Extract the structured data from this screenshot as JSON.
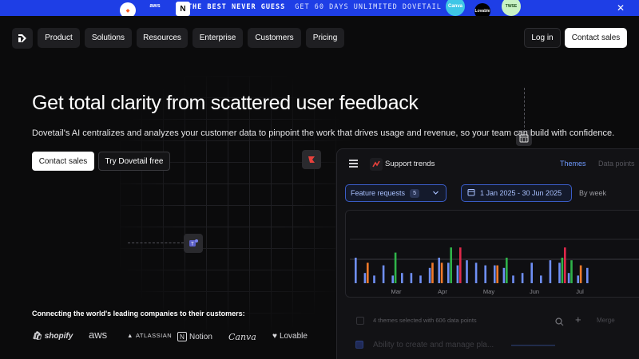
{
  "banner": {
    "headline": "THE BEST NEVER GUESS",
    "offer": "GET 60 DAYS UNLIMITED DOVETAIL →",
    "logos": [
      "aws",
      "Canva",
      "Lovable",
      "TWSE"
    ]
  },
  "nav": {
    "items": [
      "Product",
      "Solutions",
      "Resources",
      "Enterprise",
      "Customers",
      "Pricing"
    ],
    "login": "Log in",
    "contact": "Contact sales"
  },
  "hero": {
    "title": "Get total clarity from scattered user feedback",
    "subtitle": "Dovetail's AI centralizes and analyzes your customer data to pinpoint the work that drives usage and revenue, so your team can build with confidence.",
    "cta_primary": "Contact sales",
    "cta_secondary": "Try Dovetail free"
  },
  "companies": {
    "caption": "Connecting the world's leading companies to their customers:",
    "names": [
      "shopify",
      "aws",
      "ATLASSIAN",
      "Notion",
      "Canva",
      "Lovable"
    ]
  },
  "panel": {
    "title": "Support trends",
    "tabs": [
      "Themes",
      "Data points"
    ],
    "filter_label": "Feature requests",
    "filter_count": "5",
    "date_range": "1 Jan 2025 - 30 Jun 2025",
    "granularity": "By week",
    "themes_summary": "4 themes selected with 606 data points",
    "merge_label": "Merge",
    "theme_item": "Ability to create and manage pla...",
    "colors": {
      "blue": "#6f8ff5",
      "orange": "#f07a2a",
      "green": "#2fb34a",
      "red": "#e0284a"
    }
  },
  "chart_data": {
    "type": "bar",
    "x_tick_labels": [
      "Mar",
      "Apr",
      "May",
      "Jun",
      "Jul"
    ],
    "series": [
      {
        "values": [
          10,
          4,
          3,
          7,
          3,
          4,
          4,
          3,
          6,
          10,
          8,
          7,
          9,
          8,
          7,
          7,
          6,
          3,
          4,
          8,
          3,
          9,
          8,
          4,
          3,
          6
        ]
      },
      {
        "values": [
          0,
          8,
          0,
          0,
          0,
          0,
          0,
          0,
          8,
          8,
          0,
          0,
          0,
          0,
          0,
          7,
          0,
          0,
          0,
          0,
          0,
          0,
          0,
          0,
          7,
          0
        ]
      },
      {
        "values": [
          0,
          0,
          0,
          0,
          12,
          0,
          0,
          0,
          0,
          0,
          14,
          0,
          0,
          0,
          0,
          0,
          10,
          0,
          0,
          0,
          0,
          0,
          10,
          9,
          0,
          0
        ]
      },
      {
        "values": [
          0,
          0,
          0,
          0,
          0,
          0,
          0,
          0,
          0,
          0,
          0,
          14,
          0,
          0,
          0,
          0,
          0,
          0,
          0,
          0,
          0,
          0,
          14,
          0,
          0,
          0
        ]
      }
    ],
    "reference_line": true
  }
}
